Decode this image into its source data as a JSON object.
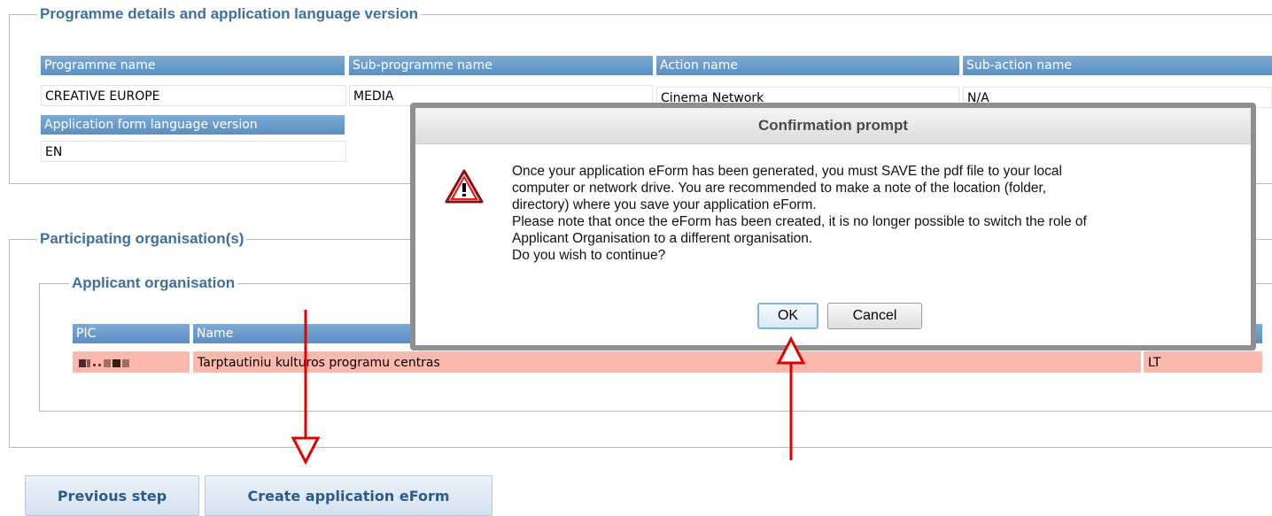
{
  "programme_section": {
    "legend": "Programme details and application language version",
    "headers": [
      "Programme name",
      "Sub-programme name",
      "Action name",
      "Sub-action name"
    ],
    "values": [
      "CREATIVE EUROPE",
      "MEDIA",
      "Cinema Network",
      "N/A"
    ],
    "language_header": "Application form language version",
    "language_value": "EN"
  },
  "participating_section": {
    "legend": "Participating organisation(s)",
    "applicant_legend": "Applicant organisation",
    "columns": [
      "PIC",
      "Name"
    ],
    "row": {
      "pic": "9... 5",
      "name": "Tarptautiniu kulturos programu centras",
      "country": "LT"
    }
  },
  "buttons": {
    "previous": "Previous step",
    "create": "Create application eForm"
  },
  "dialog": {
    "title": "Confirmation prompt",
    "lines": [
      "Once your application eForm has been generated, you must SAVE the pdf file to your local",
      "computer or network drive. You are recommended to make a note of the location (folder,",
      "directory) where you save your application eForm.",
      "Please note that once the eForm has been created, it is no longer possible to switch the role of",
      "Applicant Organisation to a different organisation.",
      "Do you wish to continue?"
    ],
    "ok_label": "OK",
    "cancel_label": "Cancel",
    "icon": "warning-icon"
  },
  "colors": {
    "header_blue": "#5a8fc3",
    "legend_blue": "#3f6f9e",
    "highlight_row": "#fbb8ad",
    "annotation_red": "#e00000"
  }
}
